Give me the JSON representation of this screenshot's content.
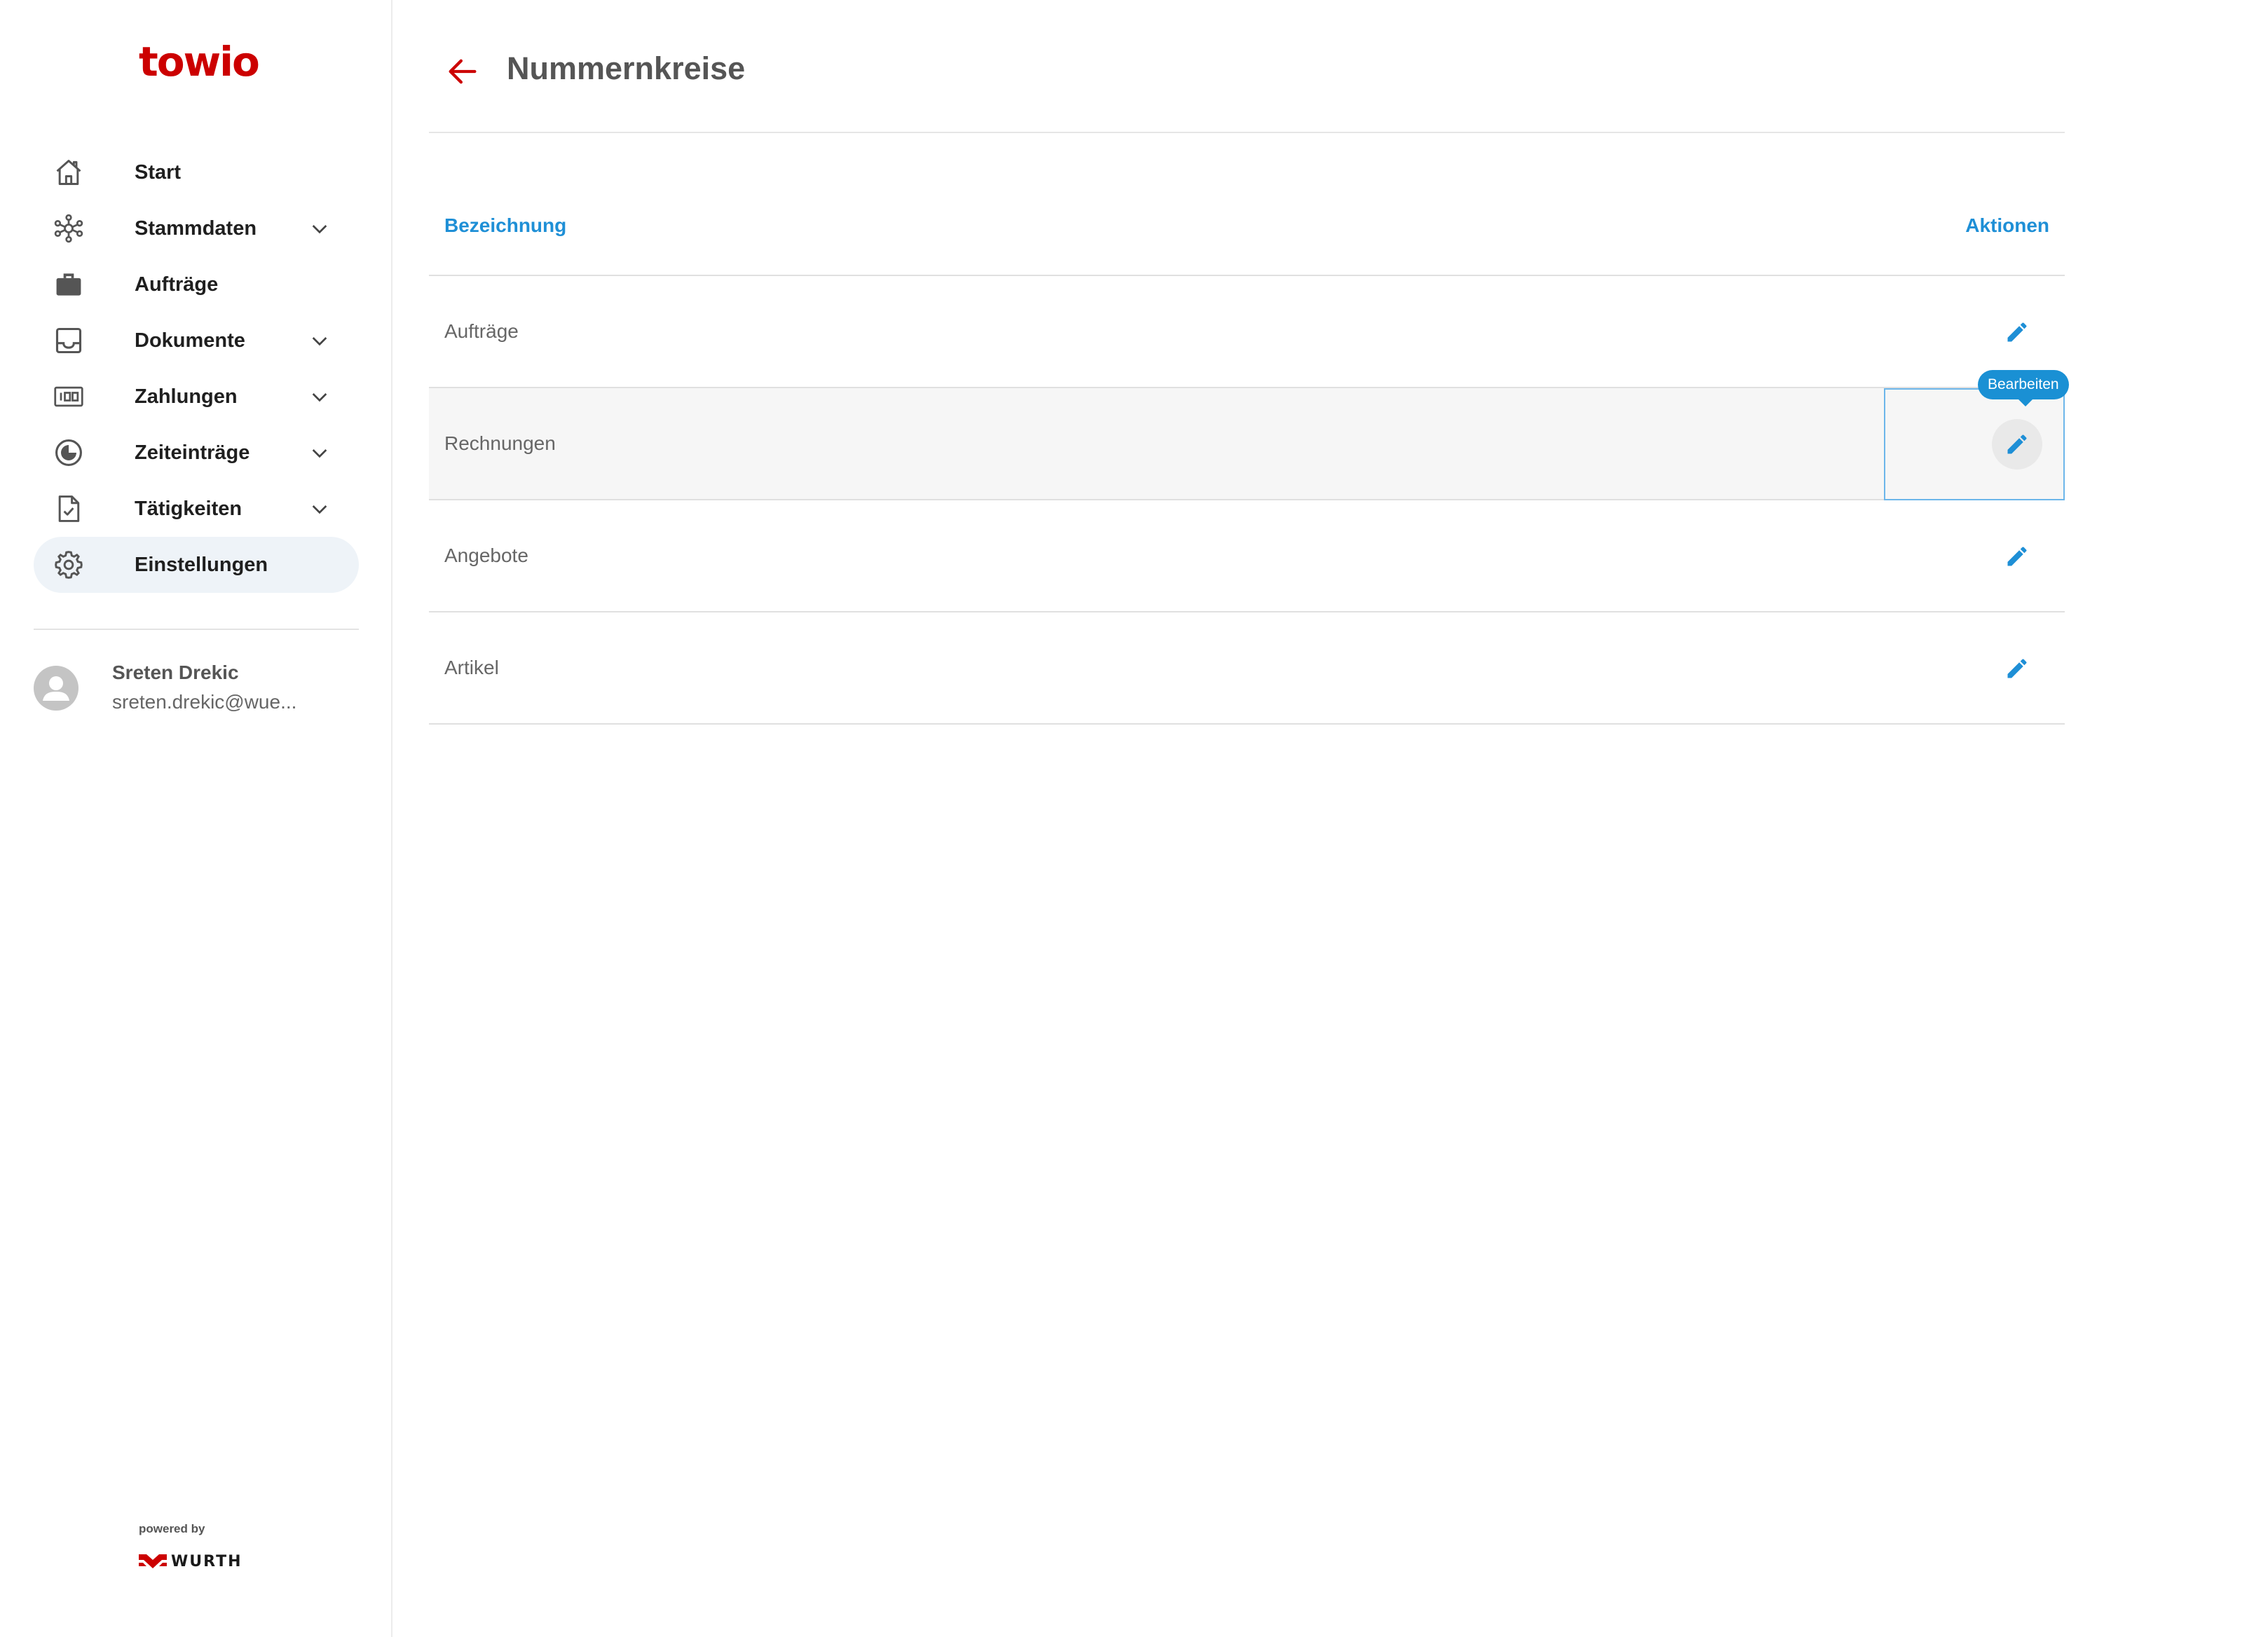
{
  "brand": {
    "logo_text": "towio",
    "logo_color": "#cc0000"
  },
  "sidebar": {
    "items": [
      {
        "label": "Start",
        "icon": "home-icon",
        "expandable": false,
        "active": false
      },
      {
        "label": "Stammdaten",
        "icon": "network-icon",
        "expandable": true,
        "active": false
      },
      {
        "label": "Aufträge",
        "icon": "briefcase-icon",
        "expandable": false,
        "active": false
      },
      {
        "label": "Dokumente",
        "icon": "inbox-icon",
        "expandable": true,
        "active": false
      },
      {
        "label": "Zahlungen",
        "icon": "counter-icon",
        "expandable": true,
        "active": false
      },
      {
        "label": "Zeiteinträge",
        "icon": "clock-icon",
        "expandable": true,
        "active": false
      },
      {
        "label": "Tätigkeiten",
        "icon": "task-document-icon",
        "expandable": true,
        "active": false
      },
      {
        "label": "Einstellungen",
        "icon": "gear-icon",
        "expandable": false,
        "active": true
      }
    ],
    "user": {
      "name": "Sreten Drekic",
      "email": "sreten.drekic@wue..."
    },
    "footer": {
      "powered_by": "powered by",
      "partner": "WURTH"
    }
  },
  "main": {
    "title": "Nummernkreise",
    "table": {
      "columns": {
        "name": "Bezeichnung",
        "actions": "Aktionen"
      },
      "rows": [
        {
          "name": "Aufträge"
        },
        {
          "name": "Rechnungen"
        },
        {
          "name": "Angebote"
        },
        {
          "name": "Artikel"
        }
      ],
      "tooltip": "Bearbeiten"
    }
  },
  "colors": {
    "accent": "#1e8fd6",
    "brand_red": "#cc0000",
    "active_bg": "#eef3f8"
  }
}
